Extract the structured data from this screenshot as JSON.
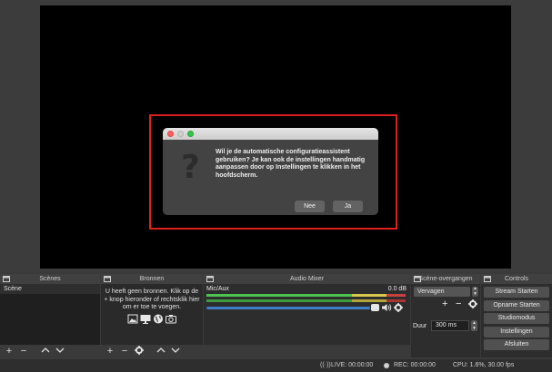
{
  "dialog": {
    "message": "Wil je de automatische configuratieassistent gebruiken? Je kan ook de instellingen handmatig aanpassen door op Instellingen te klikken in het hoofdscherm.",
    "no_label": "Nee",
    "yes_label": "Ja",
    "icon": "question-mark-icon"
  },
  "docks": {
    "scenes": {
      "title": "Scènes",
      "items": [
        "Scène"
      ]
    },
    "sources": {
      "title": "Bronnen",
      "empty_text": "U heeft geen bronnen. Klik op de + knop hieronder of rechtsklik hier om er toe te voegen."
    },
    "mixer": {
      "title": "Audio Mixer",
      "channel_name": "Mic/Aux",
      "level": "0.0 dB",
      "volume_fraction": 1.0
    },
    "transitions": {
      "title": "Scène-overgangen",
      "selected": "Vervagen",
      "duration_label": "Duur",
      "duration_value": "300 ms"
    },
    "controls": {
      "title": "Controls",
      "buttons": [
        "Stream Starten",
        "Opname Starten",
        "Studiomodus",
        "Instellingen",
        "Afsluiten"
      ]
    }
  },
  "status": {
    "live": "LIVE: 00:00:00",
    "rec": "REC: 00:00:00",
    "cpu": "CPU: 1.6%, 30.00 fps"
  },
  "colors": {
    "highlight": "#e0201b",
    "meter_green": "#4fc34f",
    "meter_yellow": "#d8c74a",
    "meter_red": "#c84040",
    "volume_blue": "#3f7ec7"
  }
}
